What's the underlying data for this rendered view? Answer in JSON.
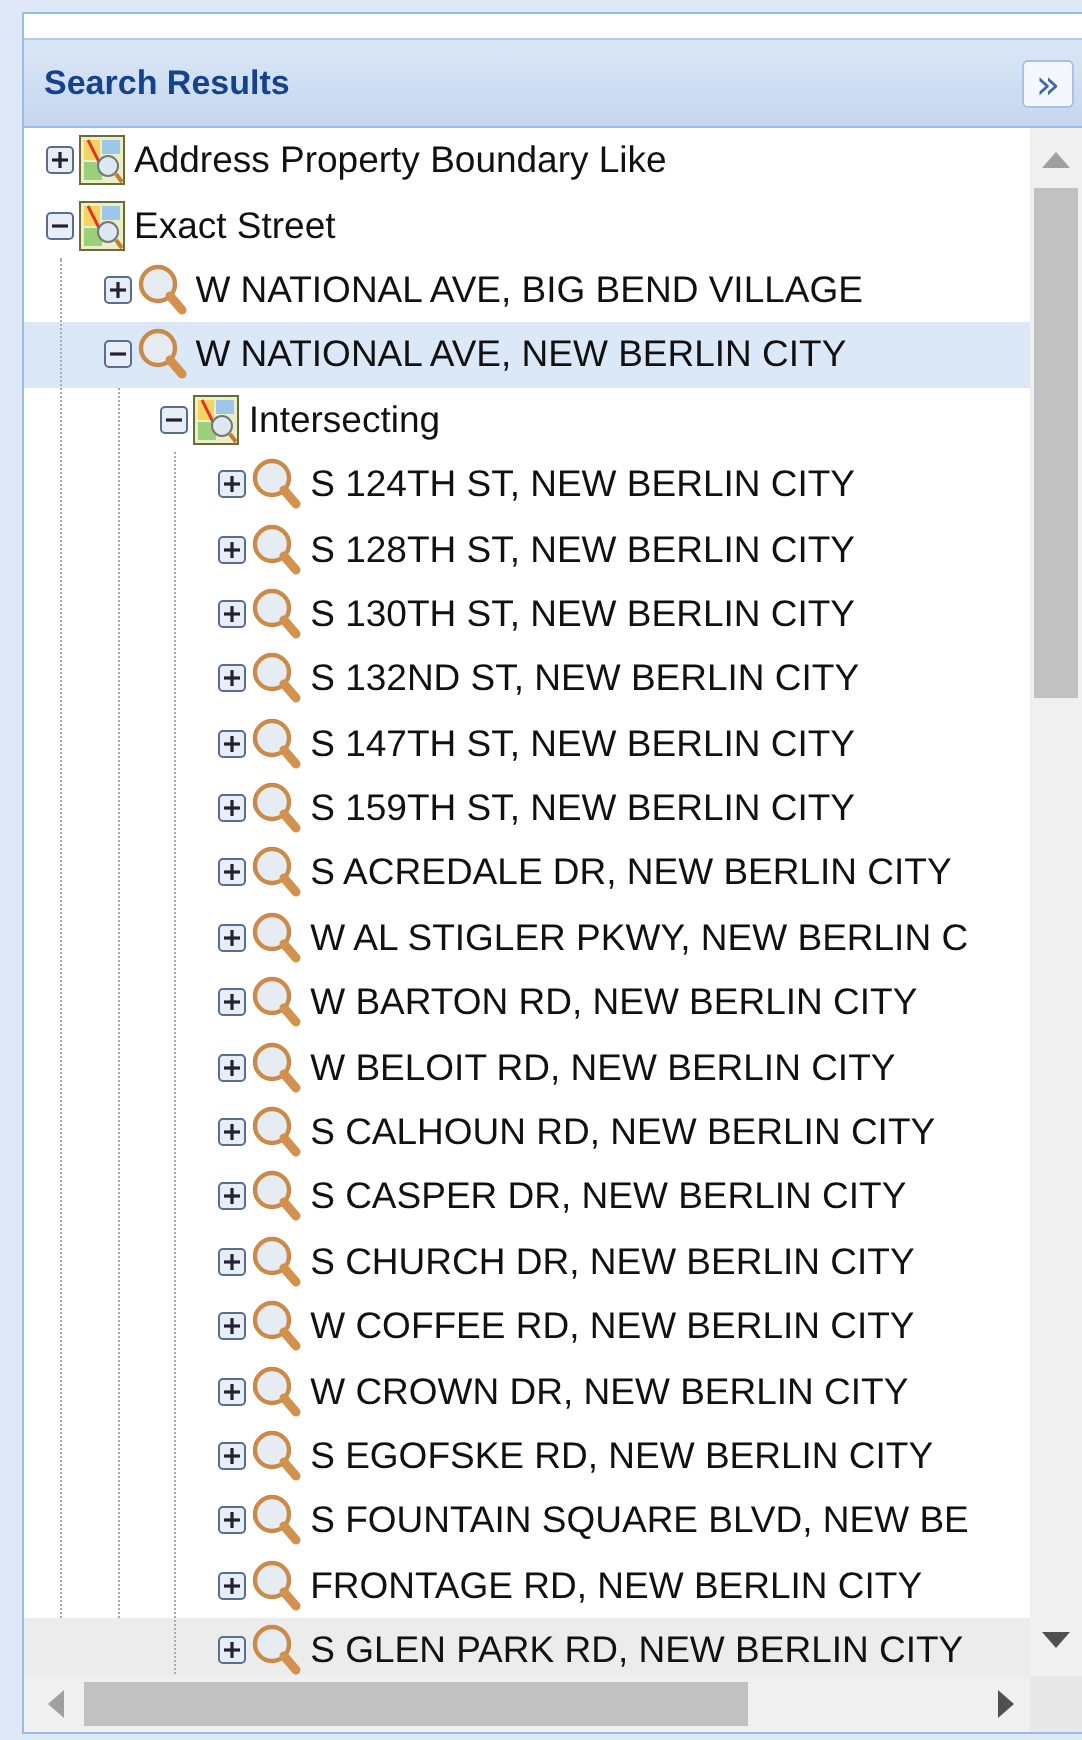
{
  "panel": {
    "title": "Search Results",
    "collapse_button": "»"
  },
  "tree": [
    {
      "kind": "layer",
      "label": "Address Property Boundary Like",
      "expanded": false,
      "selected": false,
      "hovered": false
    },
    {
      "kind": "layer",
      "label": "Exact Street",
      "expanded": true,
      "selected": false,
      "hovered": false,
      "children": [
        {
          "kind": "result",
          "label": "W NATIONAL AVE, BIG BEND VILLAGE",
          "expanded": false,
          "selected": false,
          "hovered": false
        },
        {
          "kind": "result",
          "label": "W NATIONAL AVE, NEW BERLIN CITY",
          "expanded": true,
          "selected": true,
          "hovered": false,
          "children": [
            {
              "kind": "layer",
              "label": "Intersecting",
              "expanded": true,
              "selected": false,
              "hovered": false,
              "children": [
                {
                  "kind": "result",
                  "label": "S 124TH ST, NEW BERLIN CITY",
                  "expanded": false,
                  "selected": false,
                  "hovered": false
                },
                {
                  "kind": "result",
                  "label": "S 128TH ST, NEW BERLIN CITY",
                  "expanded": false,
                  "selected": false,
                  "hovered": false
                },
                {
                  "kind": "result",
                  "label": "S 130TH ST, NEW BERLIN CITY",
                  "expanded": false,
                  "selected": false,
                  "hovered": false
                },
                {
                  "kind": "result",
                  "label": "S 132ND ST, NEW BERLIN CITY",
                  "expanded": false,
                  "selected": false,
                  "hovered": false
                },
                {
                  "kind": "result",
                  "label": "S 147TH ST, NEW BERLIN CITY",
                  "expanded": false,
                  "selected": false,
                  "hovered": false
                },
                {
                  "kind": "result",
                  "label": "S 159TH ST, NEW BERLIN CITY",
                  "expanded": false,
                  "selected": false,
                  "hovered": false
                },
                {
                  "kind": "result",
                  "label": "S ACREDALE DR, NEW BERLIN CITY",
                  "expanded": false,
                  "selected": false,
                  "hovered": false
                },
                {
                  "kind": "result",
                  "label": "W AL STIGLER PKWY, NEW BERLIN C",
                  "expanded": false,
                  "selected": false,
                  "hovered": false
                },
                {
                  "kind": "result",
                  "label": "W BARTON RD, NEW BERLIN CITY",
                  "expanded": false,
                  "selected": false,
                  "hovered": false
                },
                {
                  "kind": "result",
                  "label": "W BELOIT RD, NEW BERLIN CITY",
                  "expanded": false,
                  "selected": false,
                  "hovered": false
                },
                {
                  "kind": "result",
                  "label": "S CALHOUN RD, NEW BERLIN CITY",
                  "expanded": false,
                  "selected": false,
                  "hovered": false
                },
                {
                  "kind": "result",
                  "label": "S CASPER DR, NEW BERLIN CITY",
                  "expanded": false,
                  "selected": false,
                  "hovered": false
                },
                {
                  "kind": "result",
                  "label": "S CHURCH DR, NEW BERLIN CITY",
                  "expanded": false,
                  "selected": false,
                  "hovered": false
                },
                {
                  "kind": "result",
                  "label": "W COFFEE RD, NEW BERLIN CITY",
                  "expanded": false,
                  "selected": false,
                  "hovered": false
                },
                {
                  "kind": "result",
                  "label": "W CROWN DR, NEW BERLIN CITY",
                  "expanded": false,
                  "selected": false,
                  "hovered": false
                },
                {
                  "kind": "result",
                  "label": "S EGOFSKE RD, NEW BERLIN CITY",
                  "expanded": false,
                  "selected": false,
                  "hovered": false
                },
                {
                  "kind": "result",
                  "label": "S FOUNTAIN SQUARE BLVD, NEW BE",
                  "expanded": false,
                  "selected": false,
                  "hovered": false
                },
                {
                  "kind": "result",
                  "label": "FRONTAGE RD, NEW BERLIN CITY",
                  "expanded": false,
                  "selected": false,
                  "hovered": false
                },
                {
                  "kind": "result",
                  "label": "S GLEN PARK RD, NEW BERLIN CITY",
                  "expanded": false,
                  "selected": false,
                  "hovered": true
                }
              ]
            }
          ]
        }
      ]
    }
  ]
}
